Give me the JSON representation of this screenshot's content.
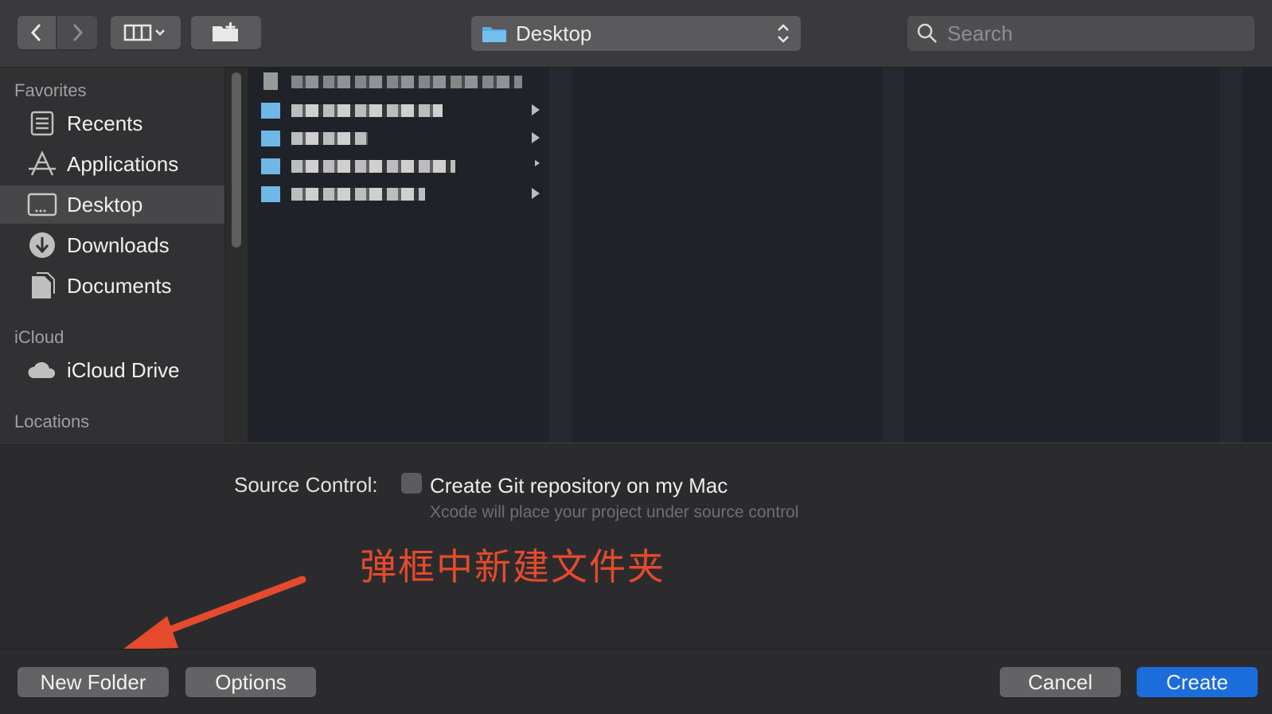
{
  "toolbar": {
    "back_icon": "chevron-left-icon",
    "forward_icon": "chevron-right-icon",
    "view_icon": "column-view-icon",
    "new_folder_icon": "folder-plus-icon",
    "location": "Desktop",
    "search_placeholder": "Search"
  },
  "sidebar": {
    "favorites_header": "Favorites",
    "items": [
      {
        "label": "Recents",
        "icon": "recents-icon"
      },
      {
        "label": "Applications",
        "icon": "applications-icon"
      },
      {
        "label": "Desktop",
        "icon": "desktop-icon",
        "selected": true
      },
      {
        "label": "Downloads",
        "icon": "downloads-icon"
      },
      {
        "label": "Documents",
        "icon": "documents-icon"
      }
    ],
    "icloud_header": "iCloud",
    "icloud_items": [
      {
        "label": "iCloud Drive",
        "icon": "cloud-icon"
      }
    ],
    "locations_header": "Locations"
  },
  "source_control": {
    "label": "Source Control:",
    "checkbox_label": "Create Git repository on my Mac",
    "checked": false,
    "hint": "Xcode will place your project under source control"
  },
  "annotation": {
    "text": "弹框中新建文件夹",
    "color": "#e54a2c"
  },
  "buttons": {
    "new_folder": "New Folder",
    "options": "Options",
    "cancel": "Cancel",
    "create": "Create"
  },
  "colors": {
    "accent": "#1a6ddb",
    "annotation": "#e54a2c"
  }
}
